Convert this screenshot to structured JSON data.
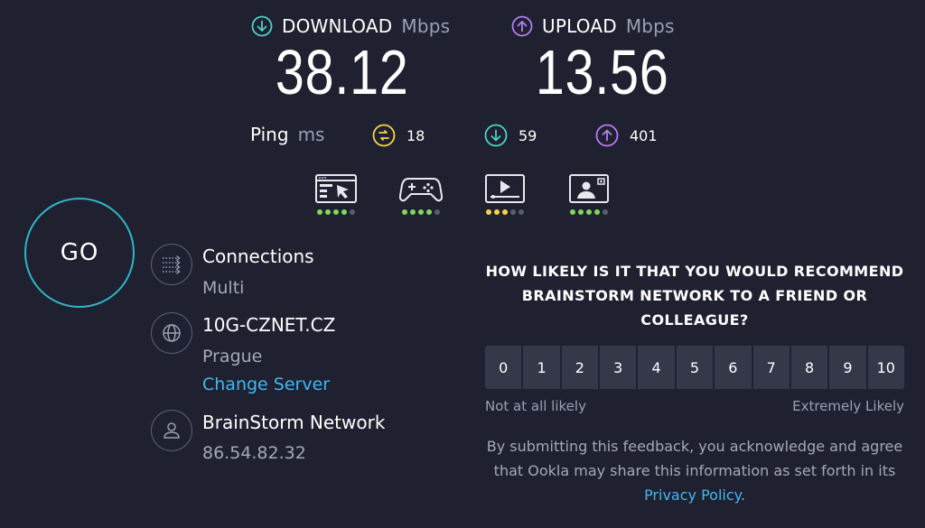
{
  "download": {
    "label": "DOWNLOAD",
    "unit": "Mbps",
    "value": "38.12",
    "color": "#4fd1c5"
  },
  "upload": {
    "label": "UPLOAD",
    "unit": "Mbps",
    "value": "13.56",
    "color": "#b57cf2"
  },
  "ping": {
    "label": "Ping",
    "unit": "ms",
    "idle": "18",
    "download": "59",
    "upload": "401",
    "idle_color": "#f5d547"
  },
  "activities": [
    {
      "icon": "web-browsing-icon",
      "level": 4,
      "dot_color": "#7ed957"
    },
    {
      "icon": "gaming-icon",
      "level": 4,
      "dot_color": "#7ed957"
    },
    {
      "icon": "video-streaming-icon",
      "level": 3,
      "dot_color": "#f5d547"
    },
    {
      "icon": "video-chat-icon",
      "level": 4,
      "dot_color": "#7ed957"
    }
  ],
  "go": {
    "label": "GO"
  },
  "connections": {
    "title": "Connections",
    "value": "Multi"
  },
  "server": {
    "title": "10G-CZNET.CZ",
    "location": "Prague",
    "change_label": "Change Server"
  },
  "provider": {
    "title": "BrainStorm Network",
    "ip": "86.54.82.32"
  },
  "survey": {
    "question": "HOW LIKELY IS IT THAT YOU WOULD RECOMMEND BRAINSTORM NETWORK TO A FRIEND OR COLLEAGUE?",
    "options": [
      "0",
      "1",
      "2",
      "3",
      "4",
      "5",
      "6",
      "7",
      "8",
      "9",
      "10"
    ],
    "low_label": "Not at all likely",
    "high_label": "Extremely Likely",
    "disclaimer_prefix": "By submitting this feedback, you acknowledge and agree that Ookla may share this information as set forth in its ",
    "privacy_link": "Privacy Policy",
    "disclaimer_suffix": "."
  }
}
